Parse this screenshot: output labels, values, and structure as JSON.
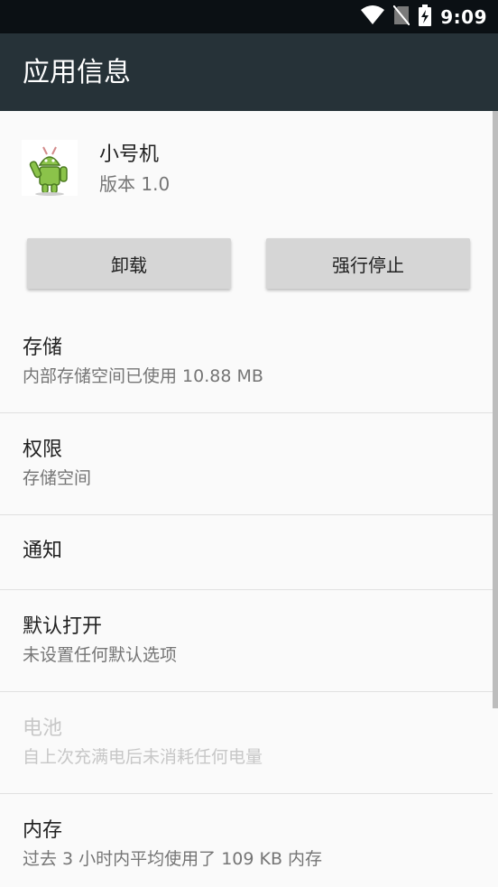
{
  "status_bar": {
    "time": "9:09",
    "icons": [
      "wifi-icon",
      "no-sim-icon",
      "battery-charging-icon"
    ]
  },
  "app_bar": {
    "title": "应用信息"
  },
  "app": {
    "name": "小号机",
    "version": "版本 1.0",
    "icon": "android-app-icon"
  },
  "buttons": {
    "uninstall": "卸载",
    "force_stop": "强行停止"
  },
  "settings": [
    {
      "title": "存储",
      "subtitle": "内部存储空间已使用 10.88 MB",
      "enabled": true
    },
    {
      "title": "权限",
      "subtitle": "存储空间",
      "enabled": true
    },
    {
      "title": "通知",
      "subtitle": "",
      "enabled": true
    },
    {
      "title": "默认打开",
      "subtitle": "未设置任何默认选项",
      "enabled": true
    },
    {
      "title": "电池",
      "subtitle": "自上次充满电后未消耗任何电量",
      "enabled": false
    },
    {
      "title": "内存",
      "subtitle": "过去 3 小时内平均使用了 109 KB 内存",
      "enabled": true
    }
  ],
  "colors": {
    "status_bar": "#0b1014",
    "app_bar": "#263238",
    "background": "#fafafa",
    "button": "#d6d6d6",
    "disabled_text": "#c7c7c7"
  }
}
